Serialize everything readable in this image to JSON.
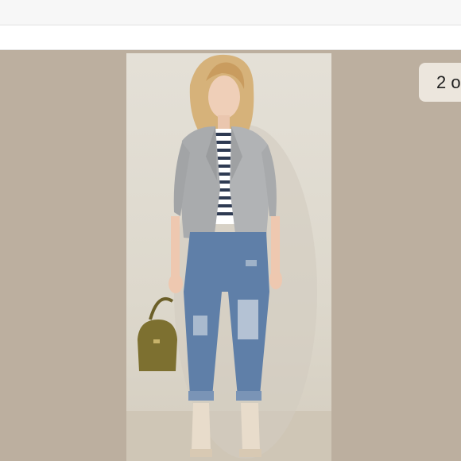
{
  "viewer": {
    "page_counter": "2 o",
    "background_color": "#bcaf9f"
  },
  "photo": {
    "icon": "photo-image"
  }
}
